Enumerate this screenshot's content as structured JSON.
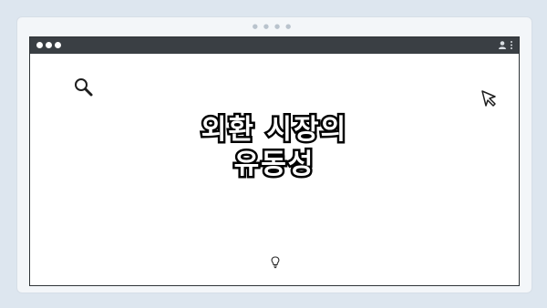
{
  "window": {
    "controls": [
      "dot",
      "dot",
      "dot"
    ],
    "toolbar_icons": [
      "user-icon",
      "kebab-icon"
    ]
  },
  "pagination": {
    "dots": 4
  },
  "slide": {
    "title_line1": "외환 시장의",
    "title_line2": "유동성",
    "icons": [
      "search-icon",
      "cursor-icon",
      "lightbulb-icon"
    ]
  },
  "colors": {
    "background": "#dde6ef",
    "titlebar": "#3a3f44",
    "title_fill": "#ffffff",
    "title_outline": "#000000"
  }
}
